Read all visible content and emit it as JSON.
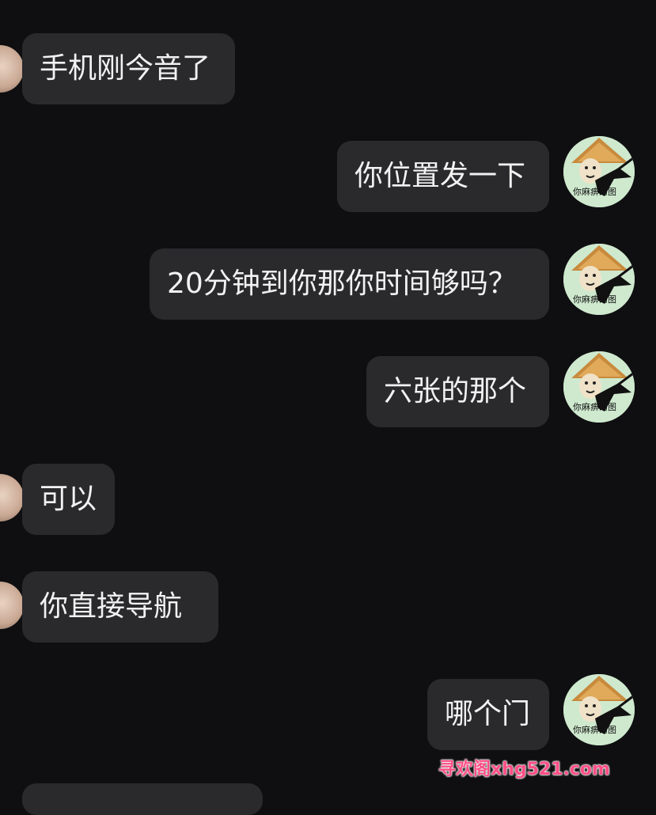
{
  "messages": [
    {
      "side": "left",
      "text": "手机刚今音了"
    },
    {
      "side": "right",
      "text": "你位置发一下"
    },
    {
      "side": "right",
      "text": "20分钟到你那你时间够吗？"
    },
    {
      "side": "right",
      "text": "六张的那个"
    },
    {
      "side": "left",
      "text": "可以"
    },
    {
      "side": "left",
      "text": "你直接导航"
    },
    {
      "side": "right",
      "text": "哪个门"
    }
  ],
  "avatar_caption": "你麻痹的图",
  "watermark": "寻欢阁xhg521.com",
  "colors": {
    "background": "#0f0f11",
    "bubble": "#2a2a2d",
    "text": "#f2f2f2",
    "watermark": "#ff4f86"
  }
}
